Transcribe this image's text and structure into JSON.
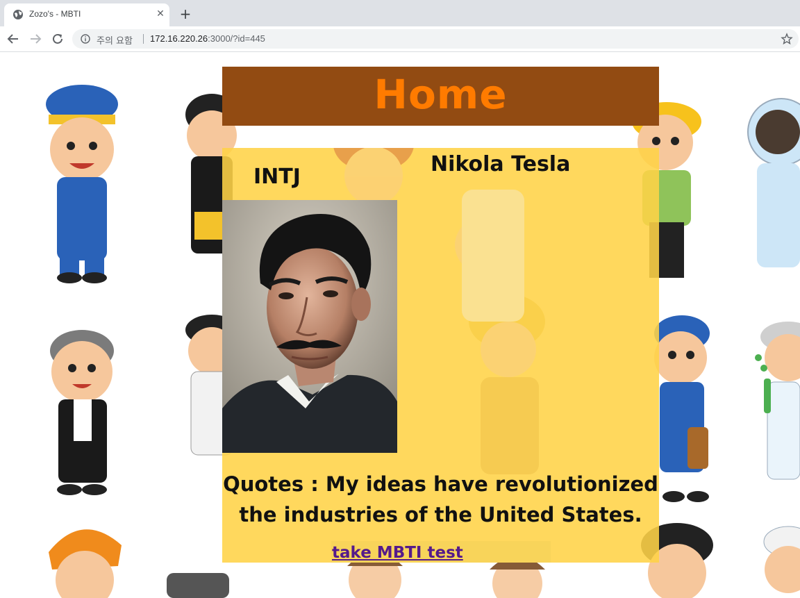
{
  "browser": {
    "tab_title": "Zozo's - MBTI",
    "security_label": "주의 요함",
    "url_host": "172.16.220.26",
    "url_rest": ":3000/?id=445",
    "new_tab_symbol": "+",
    "close_symbol": "✕"
  },
  "page": {
    "header_title": "Home",
    "mbti_type": "INTJ",
    "person_name": "Nikola Tesla",
    "quote": "Quotes : My ideas have revolutionized the industries of the United States.",
    "test_link": "take MBTI test"
  },
  "colors": {
    "header_bg": "#924b12",
    "header_text": "#ff7b00",
    "card_bg": "#ffd347",
    "link": "#551a8b"
  },
  "icons": [
    "globe-icon",
    "close-icon",
    "plus-icon",
    "back-arrow-icon",
    "forward-arrow-icon",
    "reload-icon",
    "info-icon",
    "star-icon"
  ]
}
